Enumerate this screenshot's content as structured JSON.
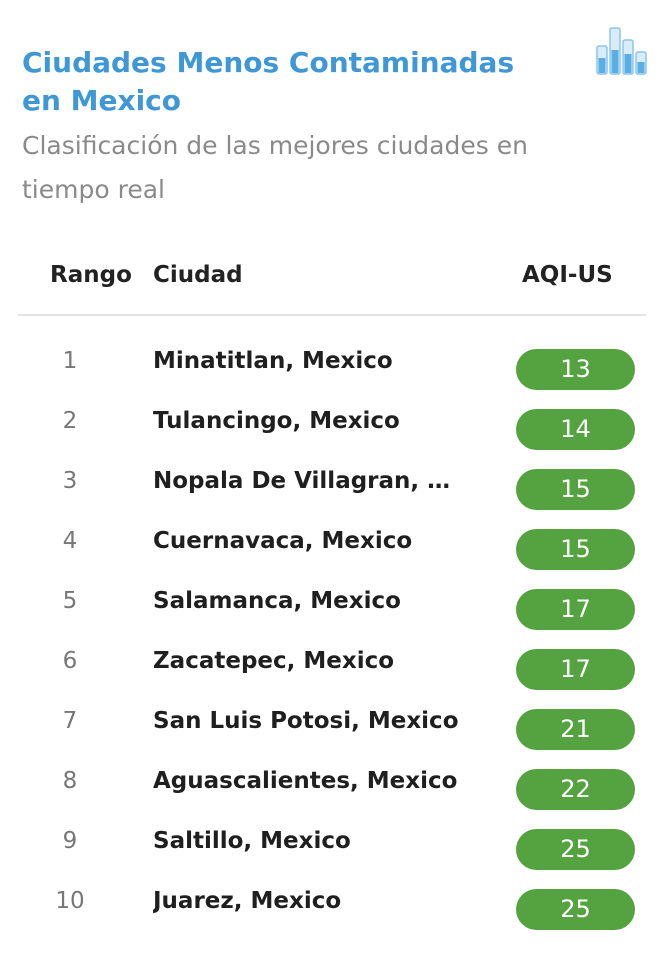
{
  "header": {
    "title": "Ciudades Menos Contaminadas en Mexico",
    "subtitle": "Clasificación de las mejores ciudades en tiempo real",
    "icon": "bar-chart-icon"
  },
  "table": {
    "columns": {
      "rank": "Rango",
      "city": "Ciudad",
      "aqi": "AQI-US"
    },
    "rows": [
      {
        "rank": "1",
        "city": "Minatitlan, Mexico",
        "aqi": "13"
      },
      {
        "rank": "2",
        "city": "Tulancingo, Mexico",
        "aqi": "14"
      },
      {
        "rank": "3",
        "city": "Nopala De Villagran, Me...",
        "aqi": "15"
      },
      {
        "rank": "4",
        "city": "Cuernavaca, Mexico",
        "aqi": "15"
      },
      {
        "rank": "5",
        "city": "Salamanca, Mexico",
        "aqi": "17"
      },
      {
        "rank": "6",
        "city": "Zacatepec, Mexico",
        "aqi": "17"
      },
      {
        "rank": "7",
        "city": "San Luis Potosi, Mexico",
        "aqi": "21"
      },
      {
        "rank": "8",
        "city": "Aguascalientes, Mexico",
        "aqi": "22"
      },
      {
        "rank": "9",
        "city": "Saltillo, Mexico",
        "aqi": "25"
      },
      {
        "rank": "10",
        "city": "Juarez, Mexico",
        "aqi": "25"
      }
    ]
  },
  "colors": {
    "title": "#3f97d6",
    "subtitle": "#8a8a8a",
    "aqi_good": "#55a340"
  }
}
